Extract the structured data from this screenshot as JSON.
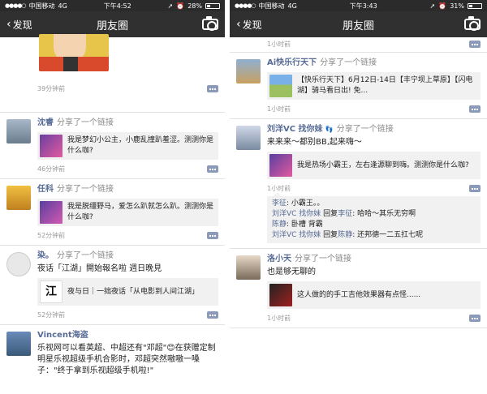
{
  "left": {
    "status": {
      "carrier": "中国移动",
      "network": "4G",
      "time": "下午4:52",
      "battery": "28%",
      "battery_level": 0.28
    },
    "nav": {
      "back_label": "发现",
      "title": "朋友圈"
    },
    "top_post": {
      "time": "39分钟前"
    },
    "posts": [
      {
        "name": "沈睿",
        "action": "分享了一个链接",
        "link_text": "我是梦幻小公主，小鹿乱撞趴羞涩。测测你是什么咖?",
        "time": "46分钟前"
      },
      {
        "name": "任科",
        "action": "分享了一个链接",
        "link_text": "我是脱缰野马，爱怎么趴就怎么趴。测测你是什么咖?",
        "time": "52分钟前"
      },
      {
        "name": "染。",
        "action": "分享了一个链接",
        "text": "夜话「江湖」開始報名啦 週日晚見",
        "link_text": "夜与日｜一拙夜话「从电影到人间江湖」",
        "time": "52分钟前"
      },
      {
        "name": "Vincent海盗",
        "text": "乐视网可以看英超、中超还有\"邓超\"😊在获赠定制明星乐视超级手机合影时，邓超突然嗷嗷一嗓子：\"终于拿到乐视超级手机啦!\""
      }
    ]
  },
  "right": {
    "status": {
      "carrier": "中国移动",
      "network": "4G",
      "time": "下午3:43",
      "battery": "31%",
      "battery_level": 0.31
    },
    "nav": {
      "back_label": "发现",
      "title": "朋友圈"
    },
    "top_post": {
      "time": "1小时前"
    },
    "posts": [
      {
        "name": "Ai快乐行天下",
        "action": "分享了一个链接",
        "link_text": "【快乐行天下】6月12日-14日【丰宁坝上草原】【闪电湖】骑马看日出! 免...",
        "time": "1小时前"
      },
      {
        "name": "刘洋VC 找你妹",
        "action": "分享了一个链接",
        "text": "来来来～都别BB,起来嗨～",
        "link_text": "我是热场小霸王，左右逢源聊到嗨。测测你是什么咖?",
        "time": "1小时前",
        "comments": [
          {
            "author": "李征",
            "sep": ": ",
            "body": "小霸王。。"
          },
          {
            "author": "刘洋VC 找你妹",
            "reply_word": " 回复",
            "target": "李征",
            "sep": ": ",
            "body": "哈哈～其乐无穷啊"
          },
          {
            "author": "陈静",
            "sep": ": ",
            "body": "卧槽 背霸"
          },
          {
            "author": "刘洋VC 找你妹",
            "reply_word": " 回复",
            "target": "陈静",
            "sep": ": ",
            "body": "还邦德一二五扛七呢"
          }
        ]
      },
      {
        "name": "洛小天",
        "action": "分享了一个链接",
        "text": "也是够无聊的",
        "link_text": "这人做的的手工吉他效果器有点怪......",
        "time": "1小时前"
      }
    ]
  },
  "colors": {
    "nav_bg": "#303030",
    "status_bg": "#2b2b2b",
    "name_blue": "#576b95",
    "link_bg": "#f1f1f1"
  }
}
